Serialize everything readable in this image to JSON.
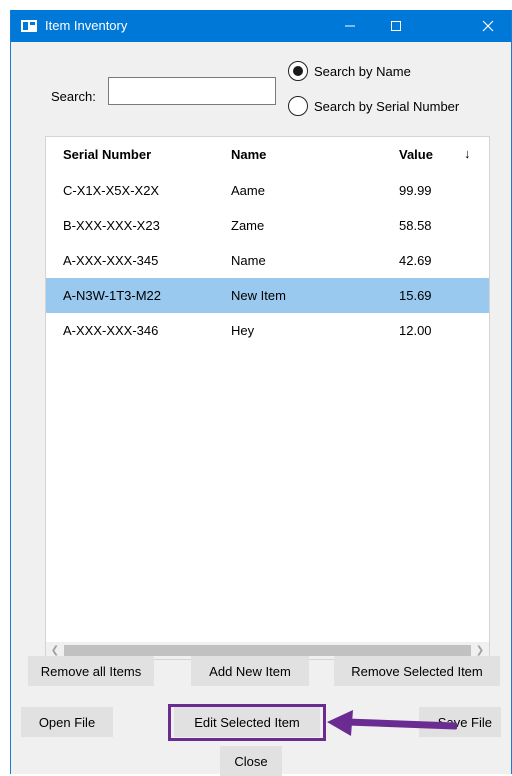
{
  "window": {
    "title": "Item Inventory"
  },
  "titlebar": {
    "minimize": "—",
    "maximize": "☐",
    "close": "✕"
  },
  "search": {
    "label": "Search:",
    "value": ""
  },
  "search_mode": {
    "by_name": {
      "label": "Search by Name",
      "selected": true
    },
    "by_serial": {
      "label": "Search by Serial Number",
      "selected": false
    }
  },
  "table": {
    "columns": {
      "serial": "Serial Number",
      "name": "Name",
      "value": "Value",
      "sort_indicator": "↓"
    },
    "rows": [
      {
        "serial": "C-X1X-X5X-X2X",
        "name": "Aame",
        "value": "99.99"
      },
      {
        "serial": "B-XXX-XXX-X23",
        "name": "Zame",
        "value": "58.58"
      },
      {
        "serial": "A-XXX-XXX-345",
        "name": "Name",
        "value": "42.69"
      },
      {
        "serial": "A-N3W-1T3-M22",
        "name": "New Item",
        "value": "15.69"
      },
      {
        "serial": "A-XXX-XXX-346",
        "name": "Hey",
        "value": "12.00"
      }
    ],
    "selected_row_index": 3
  },
  "buttons": {
    "remove_all": "Remove all Items",
    "add_new": "Add New Item",
    "remove_selected": "Remove Selected Item",
    "open_file": "Open File",
    "edit_selected": "Edit Selected Item",
    "save_file": "Save File",
    "close": "Close"
  },
  "colors": {
    "titlebar": "#0078d7",
    "selection": "#99c9ef",
    "annotation": "#6b2c91"
  }
}
